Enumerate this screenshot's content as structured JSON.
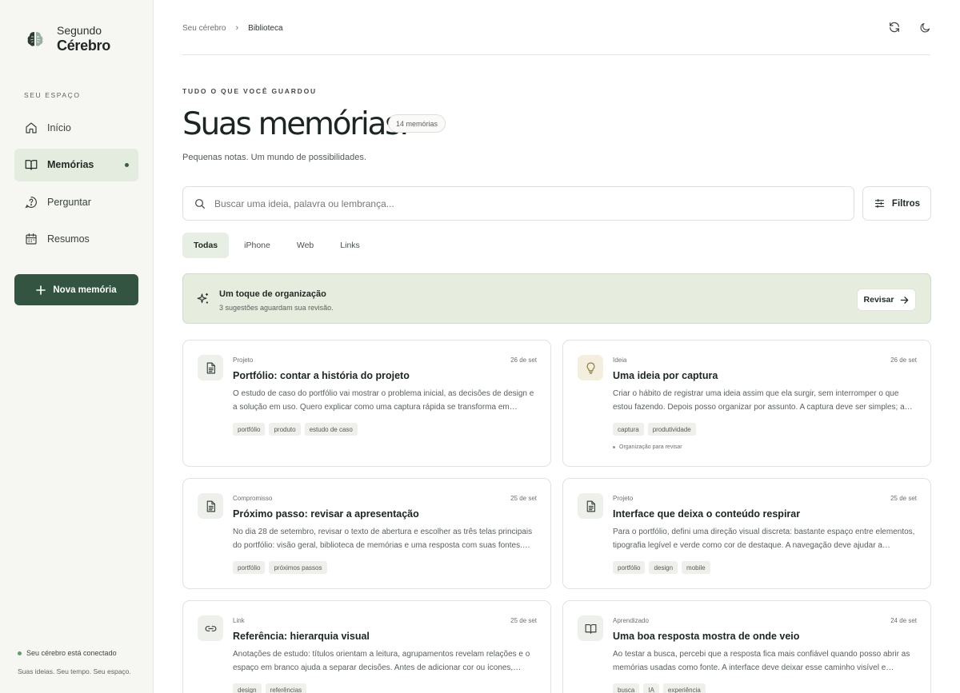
{
  "app": {
    "brand_line1": "Segundo",
    "brand_line2": "Cérebro"
  },
  "sidebar": {
    "section_label": "SEU ESPAÇO",
    "items": [
      {
        "label": "Início",
        "icon": "home-icon",
        "active": false
      },
      {
        "label": "Memórias",
        "icon": "book-icon",
        "active": true
      },
      {
        "label": "Perguntar",
        "icon": "question-icon",
        "active": false
      },
      {
        "label": "Resumos",
        "icon": "calendar-icon",
        "active": false
      }
    ],
    "new_button": "Nova memória",
    "status": "Seu cérebro está conectado",
    "tagline": "Suas ideias. Seu tempo. Seu espaço."
  },
  "header": {
    "breadcrumb_root": "Seu cérebro",
    "breadcrumb_current": "Biblioteca"
  },
  "main": {
    "eyebrow": "TUDO O QUE VOCÊ GUARDOU",
    "title": "Suas memórias.",
    "count": "14 memórias",
    "subtitle": "Pequenas notas. Um mundo de possibilidades.",
    "search_placeholder": "Buscar uma ideia, palavra ou lembrança...",
    "filters_label": "Filtros",
    "tabs": [
      "Todas",
      "iPhone",
      "Web",
      "Links"
    ],
    "active_tab": "Todas"
  },
  "banner": {
    "title": "Um toque de organização",
    "subtitle": "3 sugestões aguardam sua revisão.",
    "button": "Revisar"
  },
  "cards": [
    {
      "icon": "document-icon",
      "category": "Projeto",
      "date": "26 de set",
      "title": "Portfólio: contar a história do projeto",
      "body": "O estudo de caso do portfólio vai mostrar o problema inicial, as decisões de design e a solução em uso. Quero explicar como uma captura rápida se transforma em…",
      "tags": [
        "portfólio",
        "produto",
        "estudo de caso"
      ],
      "note": ""
    },
    {
      "icon": "lightbulb-icon",
      "category": "Ideia",
      "date": "26 de set",
      "title": "Uma ideia por captura",
      "body": "Criar o hábito de registrar uma ideia assim que ela surgir, sem interromper o que estou fazendo. Depois posso organizar por assunto. A captura deve ser simples; a…",
      "tags": [
        "captura",
        "produtividade"
      ],
      "note": "Organização para revisar"
    },
    {
      "icon": "document-icon",
      "category": "Compromisso",
      "date": "25 de set",
      "title": "Próximo passo: revisar a apresentação",
      "body": "No dia 28 de setembro, revisar o texto de abertura e escolher as três telas principais do portfólio: visão geral, biblioteca de memórias e uma resposta com suas fontes.…",
      "tags": [
        "portfólio",
        "próximos passos"
      ],
      "note": ""
    },
    {
      "icon": "document-icon",
      "category": "Projeto",
      "date": "25 de set",
      "title": "Interface que deixa o conteúdo respirar",
      "body": "Para o portfólio, defini uma direção visual discreta: bastante espaço entre elementos, tipografia legível e verde como cor de destaque. A navegação deve ajudar a encontr…",
      "tags": [
        "portfólio",
        "design",
        "mobile"
      ],
      "note": ""
    },
    {
      "icon": "link-icon",
      "category": "Link",
      "date": "25 de set",
      "title": "Referência: hierarquia visual",
      "body": "Anotações de estudo: títulos orientam a leitura, agrupamentos revelam relações e o espaço em branco ajuda a separar decisões. Antes de adicionar cor ou ícones, confe…",
      "tags": [
        "design",
        "referências"
      ],
      "note": ""
    },
    {
      "icon": "book-icon",
      "category": "Aprendizado",
      "date": "24 de set",
      "title": "Uma boa resposta mostra de onde veio",
      "body": "Ao testar a busca, percebi que a resposta fica mais confiável quando posso abrir as memórias usadas como fonte. A interface deve deixar esse caminho visível e permiti…",
      "tags": [
        "busca",
        "IA",
        "experiência"
      ],
      "note": ""
    }
  ],
  "colors": {
    "accent": "#335441",
    "active_nav_bg": "#e3ecdf",
    "banner_bg": "#e6eddf",
    "status_dot": "#5aa068"
  }
}
